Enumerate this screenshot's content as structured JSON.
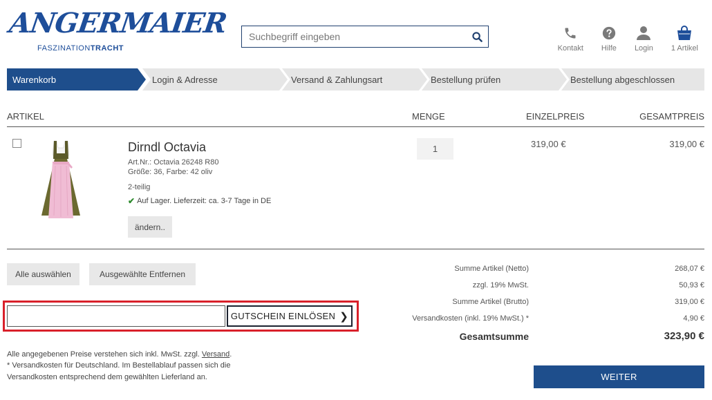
{
  "header": {
    "logo_main": "ANGERMAIER",
    "logo_sub_1": "FASZINATION",
    "logo_sub_2": "TRACHT",
    "search_placeholder": "Suchbegriff eingeben",
    "icons": [
      {
        "name": "phone-icon",
        "label": "Kontakt"
      },
      {
        "name": "help-icon",
        "label": "Hilfe"
      },
      {
        "name": "user-icon",
        "label": "Login"
      },
      {
        "name": "cart-icon",
        "label": "1 Artikel"
      }
    ]
  },
  "steps": [
    {
      "label": "Warenkorb",
      "active": true
    },
    {
      "label": "Login & Adresse",
      "active": false
    },
    {
      "label": "Versand & Zahlungsart",
      "active": false
    },
    {
      "label": "Bestellung prüfen",
      "active": false
    },
    {
      "label": "Bestellung abgeschlossen",
      "active": false
    }
  ],
  "table": {
    "headers": {
      "article": "ARTIKEL",
      "quantity": "MENGE",
      "unit_price": "EINZELPREIS",
      "total_price": "GESAMTPREIS"
    }
  },
  "item": {
    "name": "Dirndl Octavia",
    "art_nr": "Art.Nr.: Octavia 26248 R80",
    "size_color": "Größe: 36, Farbe: 42 oliv",
    "parts": "2-teilig",
    "stock": "Auf Lager. Lieferzeit: ca. 3-7 Tage in DE",
    "change_label": "ändern..",
    "quantity": "1",
    "unit_price": "319,00 €",
    "total_price": "319,00 €"
  },
  "actions": {
    "select_all": "Alle auswählen",
    "remove_selected": "Ausgewählte Entfernen",
    "voucher_button": "GUTSCHEIN EINLÖSEN",
    "voucher_value": ""
  },
  "notes": {
    "line1_prefix": "Alle angegebenen Preise verstehen sich inkl. MwSt. zzgl.",
    "line1_link": "Versand",
    "line1_suffix": ".",
    "line2": "* Versandkosten für Deutschland. Im Bestellablauf passen sich die",
    "line3": "Versandkosten entsprechend dem gewählten Lieferland an."
  },
  "summary": {
    "rows": [
      {
        "label": "Summe Artikel (Netto)",
        "value": "268,07 €"
      },
      {
        "label": "zzgl. 19% MwSt.",
        "value": "50,93 €"
      },
      {
        "label": "Summe Artikel (Brutto)",
        "value": "319,00 €"
      },
      {
        "label": "Versandkosten (inkl. 19% MwSt.) *",
        "value": "4,90 €"
      }
    ],
    "grand_label": "Gesamtsumme",
    "grand_value": "323,90 €",
    "continue_label": "WEITER"
  },
  "colors": {
    "brand_blue": "#1e4e9a",
    "step_active": "#1e4e8c",
    "step_inactive": "#e6e6e6",
    "highlight_red": "#d9202a",
    "stock_green": "#2e8b2e"
  }
}
